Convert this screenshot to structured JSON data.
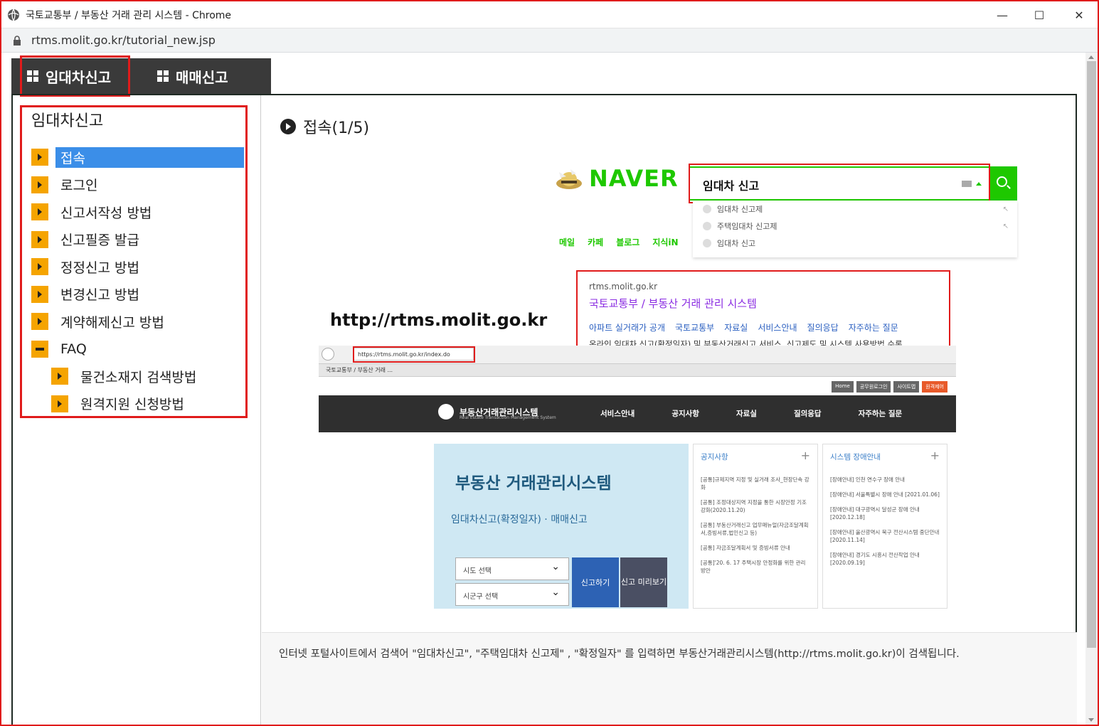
{
  "window": {
    "title": "국토교통부 / 부동산 거래 관리 시스템 - Chrome",
    "url": "rtms.molit.go.kr/tutorial_new.jsp",
    "controls": {
      "minimize": "—",
      "maximize": "☐",
      "close": "✕"
    }
  },
  "tabs": [
    {
      "label": "임대차신고",
      "icon": "grid-icon",
      "highlighted": true
    },
    {
      "label": "매매신고",
      "icon": "grid-icon",
      "highlighted": false
    }
  ],
  "sidebar": {
    "heading": "임대차신고",
    "items": [
      {
        "label": "접속",
        "active": true
      },
      {
        "label": "로그인"
      },
      {
        "label": "신고서작성 방법"
      },
      {
        "label": "신고필증 발급"
      },
      {
        "label": "정정신고 방법"
      },
      {
        "label": "변경신고 방법"
      },
      {
        "label": "계약해제신고 방법"
      },
      {
        "label": "FAQ",
        "expanded": true
      },
      {
        "label": "물건소재지 검색방법",
        "sub": true
      },
      {
        "label": "원격지원 신청방법",
        "sub": true
      }
    ]
  },
  "content": {
    "section_title": "접속(1/5)",
    "description": "인터넷 포털사이트에서 검색어 \"임대차신고\", \"주택임대차 신고제\" , \"확정일자\" 를 입력하면 부동산거래관리시스템(http://rtms.molit.go.kr)이 검색됩니다."
  },
  "illustration": {
    "naver_logo": "NAVER",
    "search_query": "임대차 신고",
    "suggestions": [
      "임대차 신고제",
      "주택임대차 신고제",
      "임대차 신고"
    ],
    "naver_links": [
      "메일",
      "카페",
      "블로그",
      "지식iN"
    ],
    "big_url": "http://rtms.molit.go.kr",
    "result": {
      "domain": "rtms.molit.go.kr",
      "title": "국토교통부 / 부동산 거래 관리 시스템",
      "links": [
        "아파트 실거래가 공개",
        "국토교통부",
        "자료실",
        "서비스안내",
        "질의응답",
        "자주하는 질문"
      ],
      "description": "온라인 임대차 신고(확정일자) 및 부동산거래신고 서비스, 신고제도 및 시스템 사용방법 수록"
    },
    "browser": {
      "address": "https://rtms.molit.go.kr/index.do",
      "tab": "국토교통부 / 부동산 거래 ...",
      "top_buttons": [
        "Home",
        "공무원로그인",
        "사이트맵",
        "원격제어"
      ],
      "site_name": "부동산거래관리시스템",
      "site_sub": "Real Estate Transaction Management System",
      "nav": [
        "서비스안내",
        "공지사항",
        "자료실",
        "질의응답",
        "자주하는 질문"
      ]
    },
    "hero": {
      "title": "부동산 거래관리시스템",
      "subtitle": "임대차신고(확정일자) · 매매신고",
      "select1": "시도 선택",
      "select2": "시군구 선택",
      "btn_report": "신고하기",
      "btn_preview": "신고 미리보기"
    },
    "notice": {
      "heading": "공지사항",
      "items": [
        "[공통]규제지역 지정 및 실거래 조사_현장단속 강화",
        "[공통] 조정대상지역 지정을 통한 시장안정 기조 강화(2020.11.20)",
        "[공통] 부동산거래신고 업무매뉴얼(자금조달계획서,증빙서류,법인신고 등)",
        "[공통] 자금조달계획서 및 증빙서류 안내",
        "[공통]'20. 6. 17 주택시장 안정화를 위한 관리방안"
      ]
    },
    "outage": {
      "heading": "시스템 장애안내",
      "items": [
        "[장애안내] 인천 연수구 장애 안내",
        "[장애안내] 서울특별시 장애 안내 [2021.01.06]",
        "[장애안내] 대구광역시 달성군 장애 안내 [2020.12.18]",
        "[장애안내] 울산광역시 북구 전산시스템 중단안내 [2020.11.14]",
        "[장애안내] 경기도 시흥시 전산작업 안내 [2020.09.19]"
      ]
    }
  },
  "colors": {
    "highlight_red": "#e01b1b",
    "active_blue": "#3b8ee8",
    "arrow_orange": "#f5a400",
    "naver_green": "#1ec800"
  }
}
